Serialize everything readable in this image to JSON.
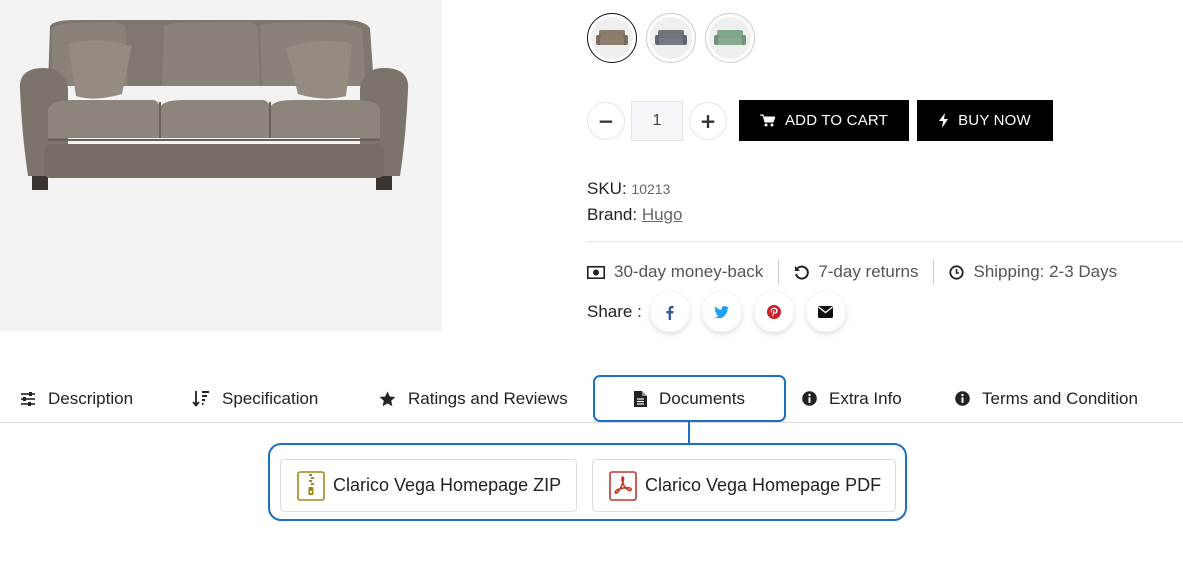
{
  "product": {
    "image_alt": "sofa-image",
    "swatches": [
      {
        "name": "brown-sofa-swatch",
        "color": "#8a7a6a",
        "selected": true
      },
      {
        "name": "gray-sofa-swatch",
        "color": "#6e747c",
        "selected": false
      },
      {
        "name": "green-sofa-swatch",
        "color": "#7fa58a",
        "selected": false
      }
    ]
  },
  "purchase": {
    "quantity": "1",
    "minus_label": "−",
    "plus_label": "+",
    "add_to_cart": "ADD TO CART",
    "buy_now": "BUY NOW"
  },
  "meta": {
    "sku_label": "SKU:",
    "sku_value": "10213",
    "brand_label": "Brand:",
    "brand_value": "Hugo"
  },
  "features": [
    {
      "icon": "money-icon",
      "text": "30-day money-back"
    },
    {
      "icon": "undo-icon",
      "text": "7-day returns"
    },
    {
      "icon": "clock-icon",
      "text": "Shipping: 2-3 Days"
    }
  ],
  "share": {
    "label": "Share :",
    "networks": [
      {
        "icon": "facebook-icon",
        "color": "#3b5998"
      },
      {
        "icon": "twitter-icon",
        "color": "#1da1f2"
      },
      {
        "icon": "pinterest-icon",
        "color": "#cb2027"
      },
      {
        "icon": "envelope-icon",
        "color": "#111111"
      }
    ]
  },
  "tabs": [
    {
      "label": "Description",
      "icon": "sliders-icon"
    },
    {
      "label": "Specification",
      "icon": "sort-icon"
    },
    {
      "label": "Ratings and Reviews",
      "icon": "star-icon"
    },
    {
      "label": "Documents",
      "icon": "file-icon",
      "active": true
    },
    {
      "label": "Extra Info",
      "icon": "info-icon"
    },
    {
      "label": "Terms and Condition",
      "icon": "info-icon"
    }
  ],
  "documents": [
    {
      "label": "Clarico Vega Homepage ZIP",
      "icon": "zip-file-icon",
      "color": "#a08a10"
    },
    {
      "label": "Clarico Vega Homepage PDF",
      "icon": "pdf-file-icon",
      "color": "#c0392b"
    }
  ],
  "colors": {
    "highlight": "#1d6fc4",
    "button_bg": "#000000"
  }
}
